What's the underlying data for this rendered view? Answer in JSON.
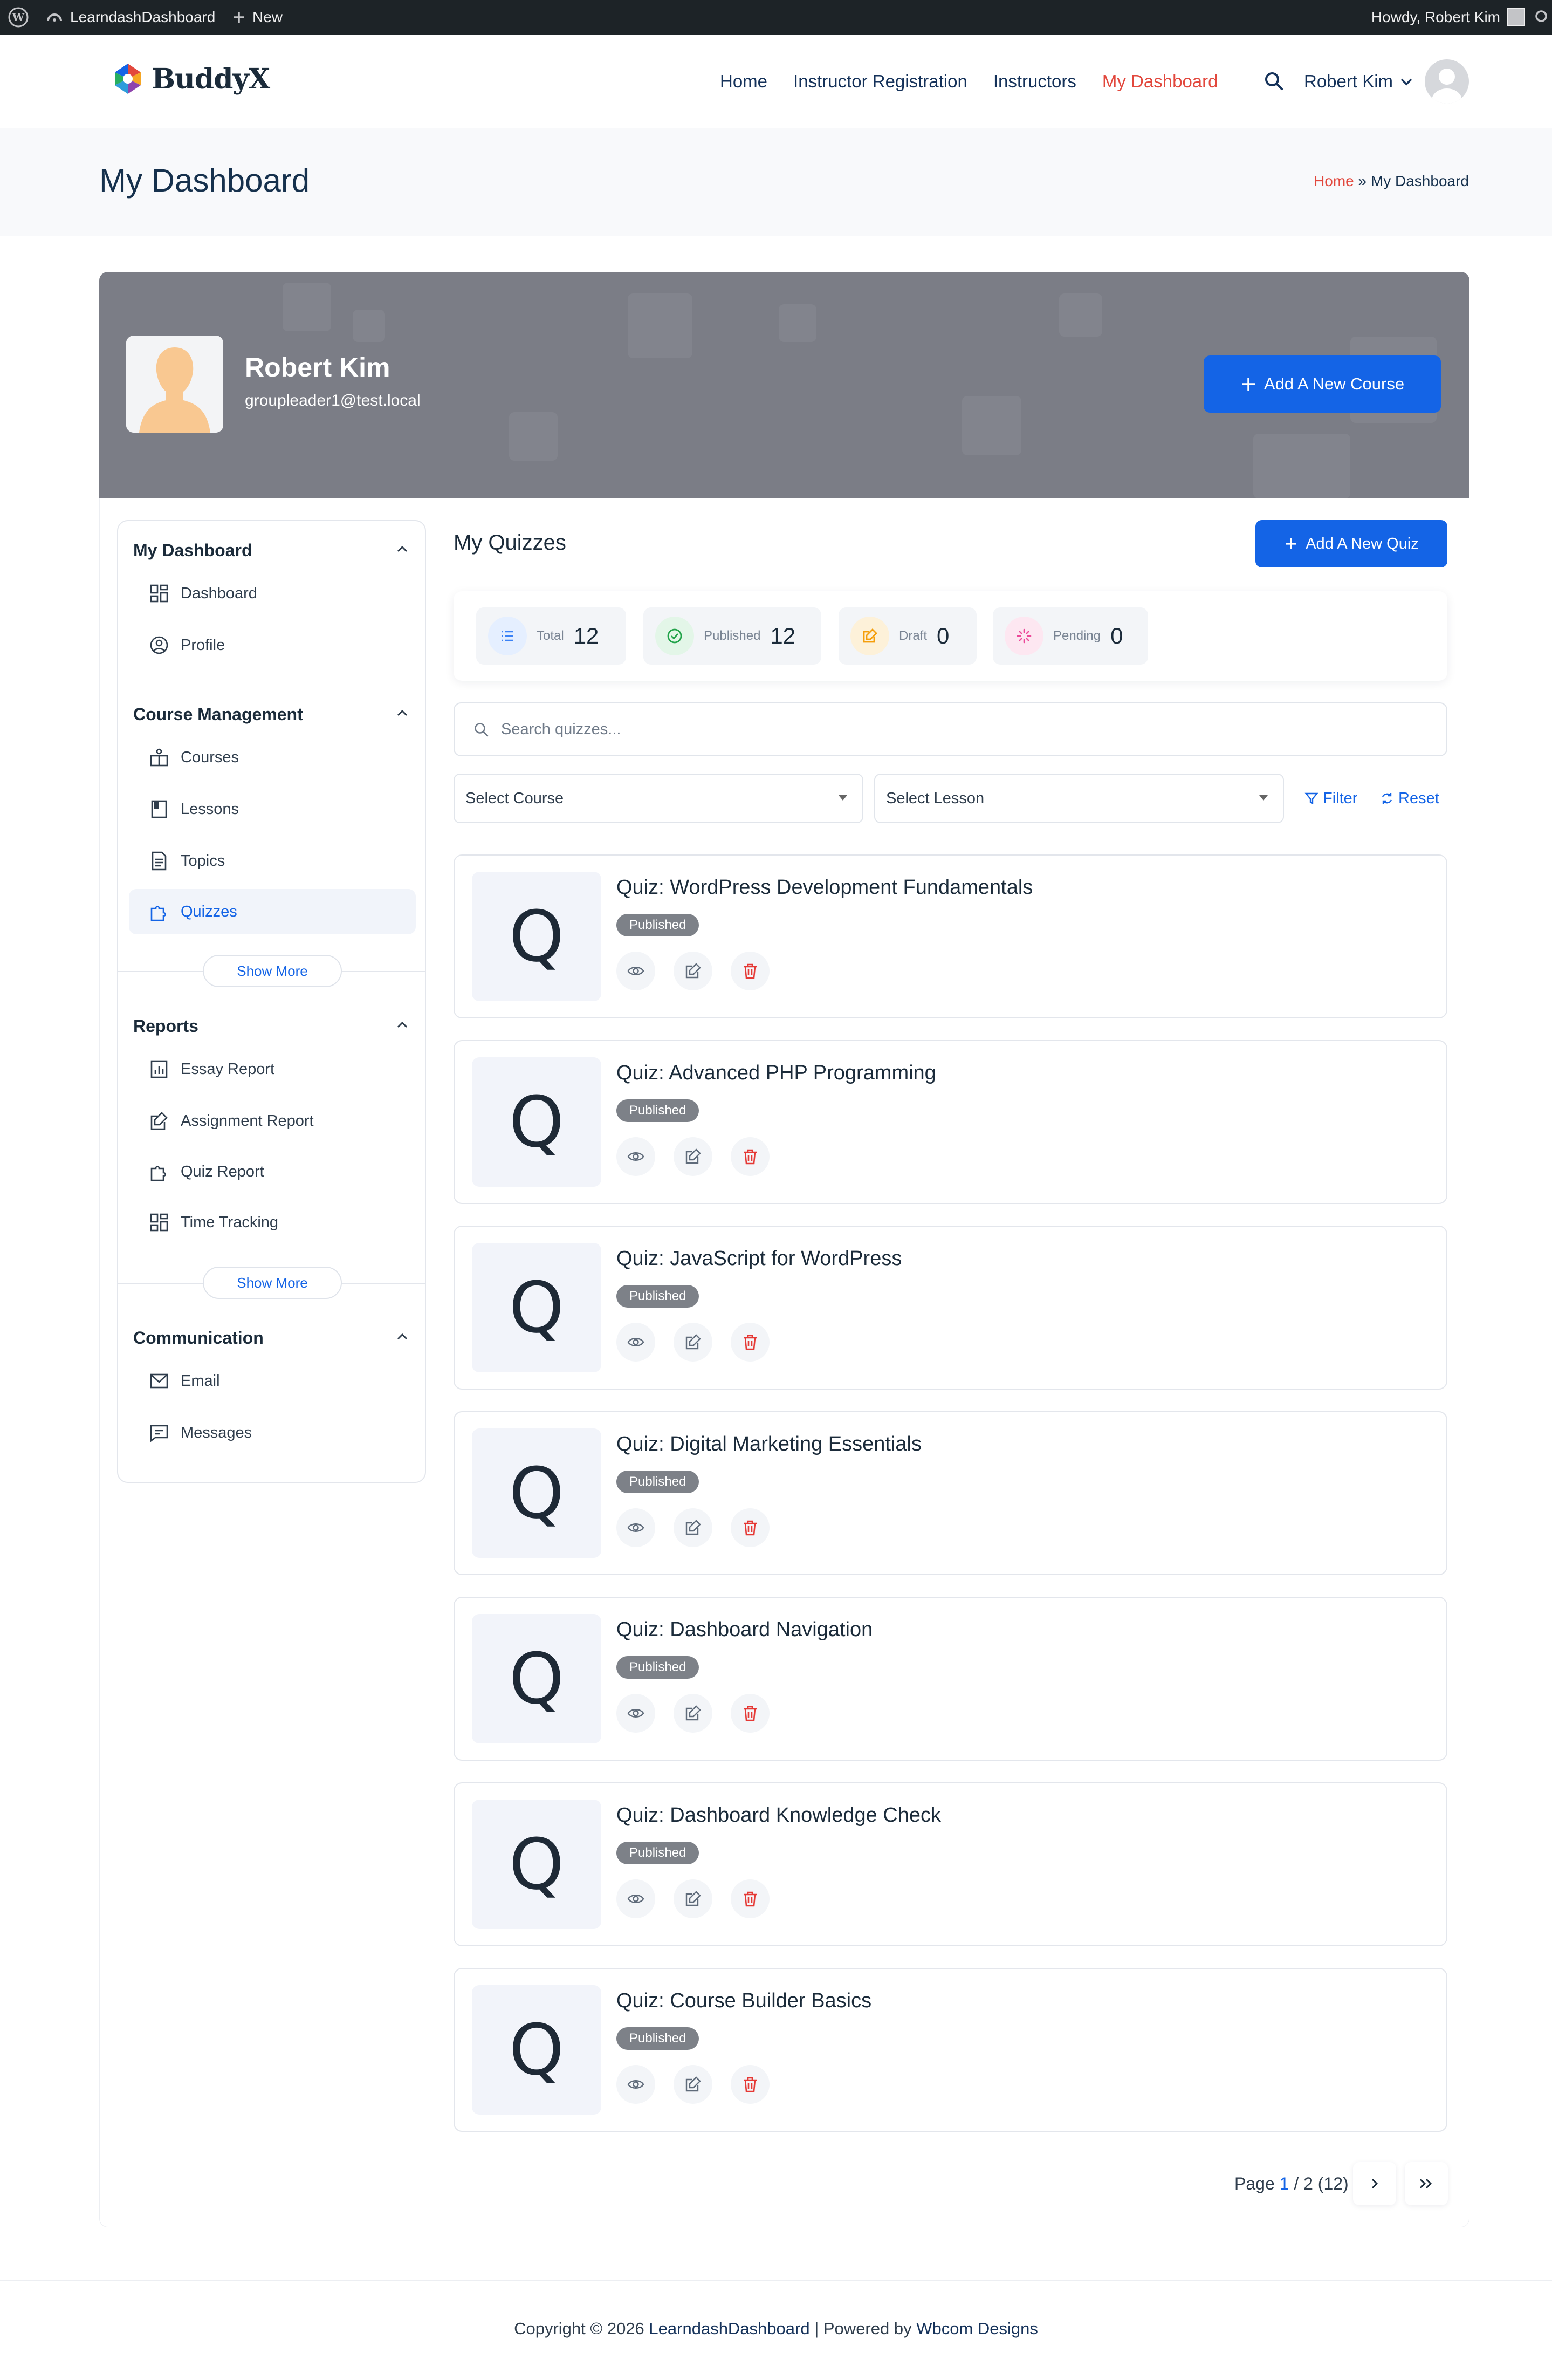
{
  "adminbar": {
    "site_name": "LearndashDashboard",
    "new_label": "New",
    "howdy": "Howdy, Robert Kim"
  },
  "header": {
    "logo_text": "BuddyX",
    "nav": [
      "Home",
      "Instructor Registration",
      "Instructors",
      "My Dashboard"
    ],
    "active_nav": "My Dashboard",
    "user_name": "Robert Kim"
  },
  "titleband": {
    "title": "My Dashboard",
    "breadcrumb_home": "Home",
    "breadcrumb_sep": "»",
    "breadcrumb_current": "My Dashboard"
  },
  "profile": {
    "name": "Robert Kim",
    "email": "groupleader1@test.local",
    "add_course_label": "Add A New Course"
  },
  "sidebar": {
    "sections": [
      {
        "title": "My Dashboard",
        "items": [
          {
            "label": "Dashboard",
            "icon": "grid-icon"
          },
          {
            "label": "Profile",
            "icon": "user-circle-icon"
          }
        ]
      },
      {
        "title": "Course Management",
        "items": [
          {
            "label": "Courses",
            "icon": "courses-icon"
          },
          {
            "label": "Lessons",
            "icon": "book-icon"
          },
          {
            "label": "Topics",
            "icon": "document-icon"
          },
          {
            "label": "Quizzes",
            "icon": "puzzle-icon",
            "active": true
          }
        ],
        "show_more": "Show More"
      },
      {
        "title": "Reports",
        "items": [
          {
            "label": "Essay Report",
            "icon": "chart-icon"
          },
          {
            "label": "Assignment Report",
            "icon": "edit-note-icon"
          },
          {
            "label": "Quiz Report",
            "icon": "puzzle-icon"
          },
          {
            "label": "Time Tracking",
            "icon": "grid-icon"
          }
        ],
        "show_more": "Show More"
      },
      {
        "title": "Communication",
        "items": [
          {
            "label": "Email",
            "icon": "mail-icon"
          },
          {
            "label": "Messages",
            "icon": "message-icon"
          }
        ]
      }
    ]
  },
  "quizzes": {
    "title": "My Quizzes",
    "add_quiz_label": "Add A New Quiz",
    "stats": [
      {
        "label": "Total",
        "value": "12",
        "color": "#3b82f6"
      },
      {
        "label": "Published",
        "value": "12",
        "color": "#22a34a"
      },
      {
        "label": "Draft",
        "value": "0",
        "color": "#f59e0b"
      },
      {
        "label": "Pending",
        "value": "0",
        "color": "#ec4899"
      }
    ],
    "search_placeholder": "Search quizzes...",
    "select_course": "Select Course",
    "select_lesson": "Select Lesson",
    "filter_label": "Filter",
    "reset_label": "Reset",
    "thumb_letter": "Q",
    "items": [
      {
        "title": "Quiz: WordPress Development Fundamentals",
        "status": "Published"
      },
      {
        "title": "Quiz: Advanced PHP Programming",
        "status": "Published"
      },
      {
        "title": "Quiz: JavaScript for WordPress",
        "status": "Published"
      },
      {
        "title": "Quiz: Digital Marketing Essentials",
        "status": "Published"
      },
      {
        "title": "Quiz: Dashboard Navigation",
        "status": "Published"
      },
      {
        "title": "Quiz: Dashboard Knowledge Check",
        "status": "Published"
      },
      {
        "title": "Quiz: Course Builder Basics",
        "status": "Published"
      }
    ],
    "pagination": {
      "prefix": "Page",
      "current": "1",
      "rest": "/ 2 (12)"
    }
  },
  "footer": {
    "prefix": "Copyright © 2026",
    "site": "LearndashDashboard",
    "middle": "| Powered by",
    "company": "Wbcom Designs"
  },
  "colors": {
    "accent": "#1464e6",
    "nav_active": "#e2483d",
    "danger": "#e53935"
  }
}
